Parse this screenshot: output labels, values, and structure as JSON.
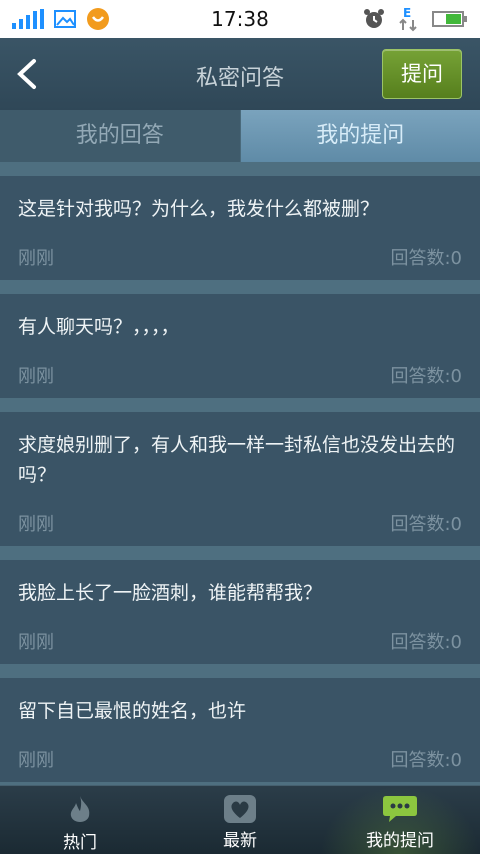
{
  "status_bar": {
    "time": "17:38"
  },
  "header": {
    "title": "私密问答",
    "ask_button": "提问"
  },
  "tabs": [
    {
      "label": "我的回答",
      "active": false
    },
    {
      "label": "我的提问",
      "active": true
    }
  ],
  "questions": [
    {
      "text": "这是针对我吗？为什么，我发什么都被删？",
      "time": "刚刚",
      "answers": "回答数:0"
    },
    {
      "text": "有人聊天吗？，，，，",
      "time": "刚刚",
      "answers": "回答数:0"
    },
    {
      "text": "求度娘别删了，有人和我一样一封私信也没发出去的吗？",
      "time": "刚刚",
      "answers": "回答数:0"
    },
    {
      "text": "我脸上长了一脸酒刺，谁能帮帮我？",
      "time": "刚刚",
      "answers": "回答数:0"
    },
    {
      "text": "留下自已最恨的姓名，也许",
      "time": "刚刚",
      "answers": "回答数:0"
    }
  ],
  "bottom_nav": [
    {
      "label": "热门",
      "icon": "flame-icon"
    },
    {
      "label": "最新",
      "icon": "heart-icon"
    },
    {
      "label": "我的提问",
      "icon": "chat-icon",
      "active": true
    }
  ],
  "colors": {
    "accent_green": "#6a9a2e",
    "background": "#4e6f80",
    "active_tab": "#6f9ab5"
  }
}
